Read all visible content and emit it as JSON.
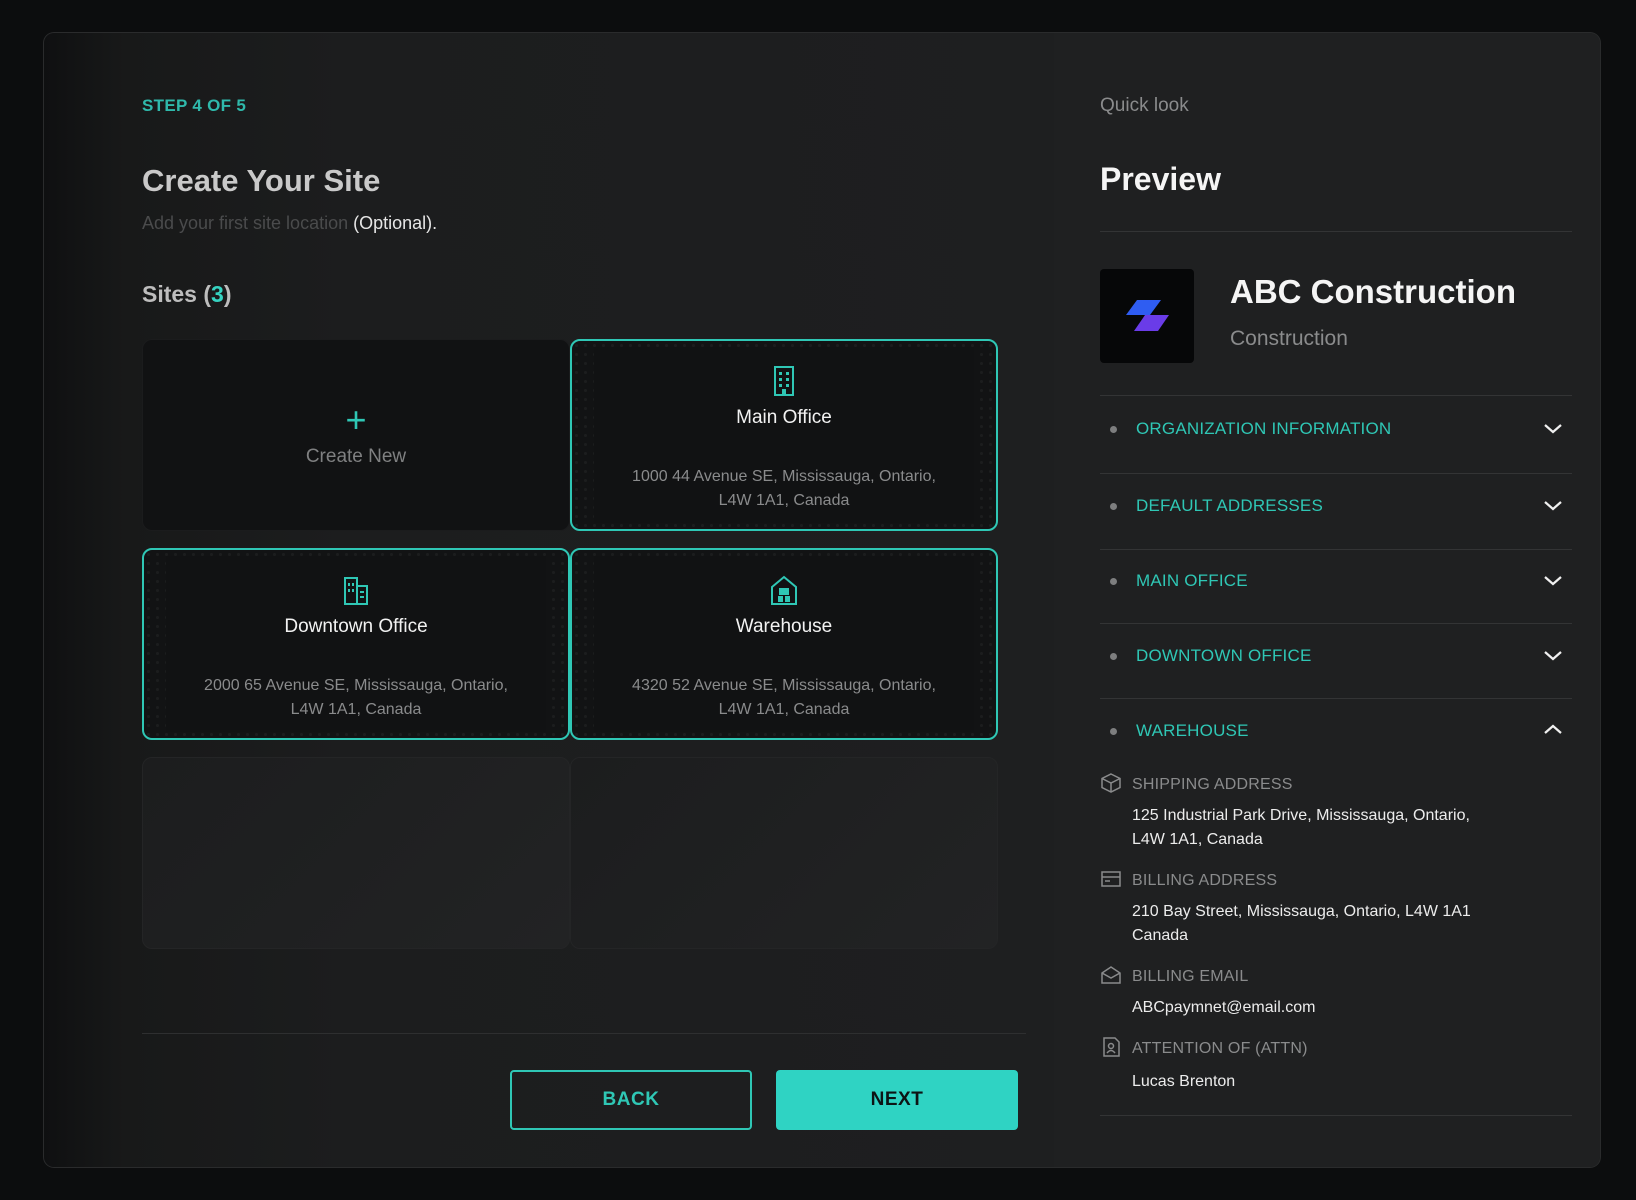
{
  "wizard": {
    "step": "STEP 4 OF 5",
    "title": "Create Your Site",
    "subtitle": "Add your first site location",
    "subtitle_optional": "(Optional).",
    "sites_label": "Sites",
    "sites_count_open": "(",
    "sites_count": "3",
    "sites_count_close": ")",
    "create_new": "Create New",
    "sites": [
      {
        "name": "Main Office",
        "icon": "building-icon",
        "address_line1": "1000 44 Avenue SE, Mississauga, Ontario,",
        "address_line2": "L4W 1A1, Canada"
      },
      {
        "name": "Downtown Office",
        "icon": "office-buildings-icon",
        "address_line1": "2000 65 Avenue SE, Mississauga, Ontario,",
        "address_line2": "L4W 1A1, Canada"
      },
      {
        "name": "Warehouse",
        "icon": "warehouse-icon",
        "address_line1": "4320 52 Avenue SE, Mississauga, Ontario,",
        "address_line2": "L4W 1A1, Canada"
      }
    ],
    "back_label": "BACK",
    "next_label": "NEXT"
  },
  "preview": {
    "quick_look": "Quick look",
    "title": "Preview",
    "org_name": "ABC Construction",
    "org_type": "Construction",
    "sections": [
      {
        "label": "ORGANIZATION INFORMATION",
        "expanded": false
      },
      {
        "label": "DEFAULT ADDRESSES",
        "expanded": false
      },
      {
        "label": "MAIN OFFICE",
        "expanded": false
      },
      {
        "label": "DOWNTOWN OFFICE",
        "expanded": false
      },
      {
        "label": "WAREHOUSE",
        "expanded": true
      }
    ],
    "warehouse_details": {
      "shipping_label": "SHIPPING ADDRESS",
      "shipping_line1": "125 Industrial Park Drive, Mississauga, Ontario,",
      "shipping_line2": "L4W 1A1, Canada",
      "billing_label": "BILLING ADDRESS",
      "billing_line1": "210 Bay Street, Mississauga, Ontario, L4W 1A1",
      "billing_line2": "Canada",
      "email_label": "BILLING EMAIL",
      "email": "ABCpaymnet@email.com",
      "attn_label": "ATTENTION OF (ATTN)",
      "attn": "Lucas Brenton"
    }
  },
  "colors": {
    "accent": "#2fc7b5",
    "background": "#1d1e1f",
    "card": "#111213"
  }
}
